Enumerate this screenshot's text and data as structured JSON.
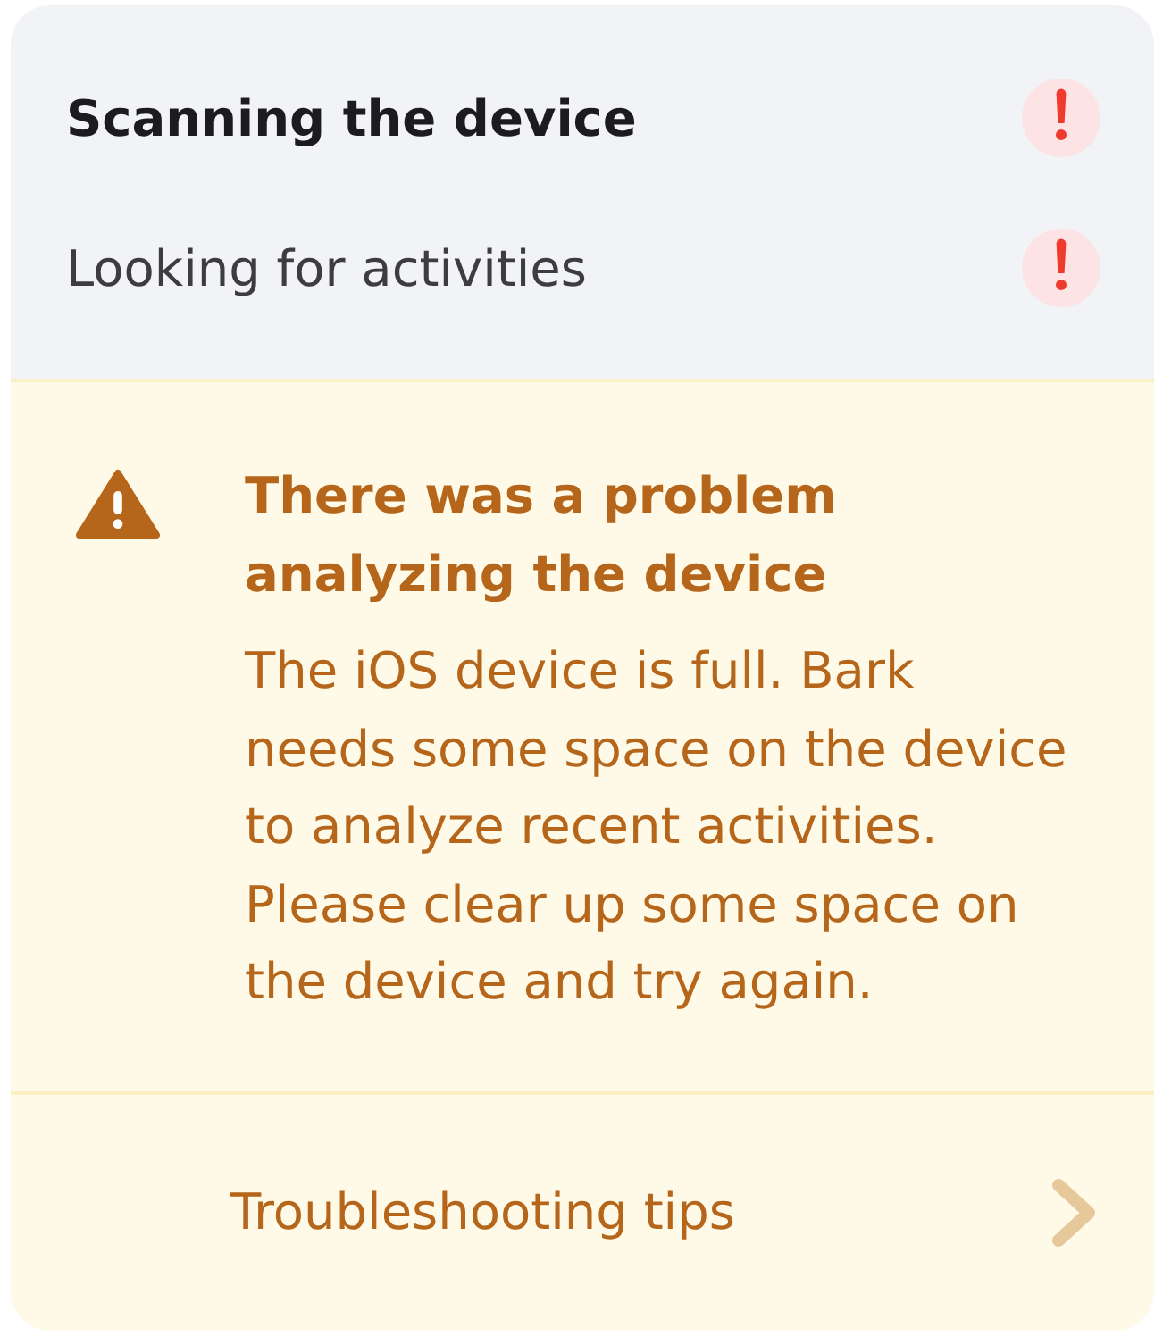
{
  "steps": [
    {
      "kind": "title",
      "label": "Scanning the device",
      "failed": true
    },
    {
      "kind": "step",
      "label": "Looking for activities",
      "failed": true
    }
  ],
  "alert": {
    "kind": "warning",
    "title": "There was a problem analyzing the device",
    "message": "The iOS device is full. Bark needs some space on the device to analyze recent activities. Please clear up some space on the device and try again."
  },
  "link": {
    "label": "Troubleshooting tips"
  }
}
